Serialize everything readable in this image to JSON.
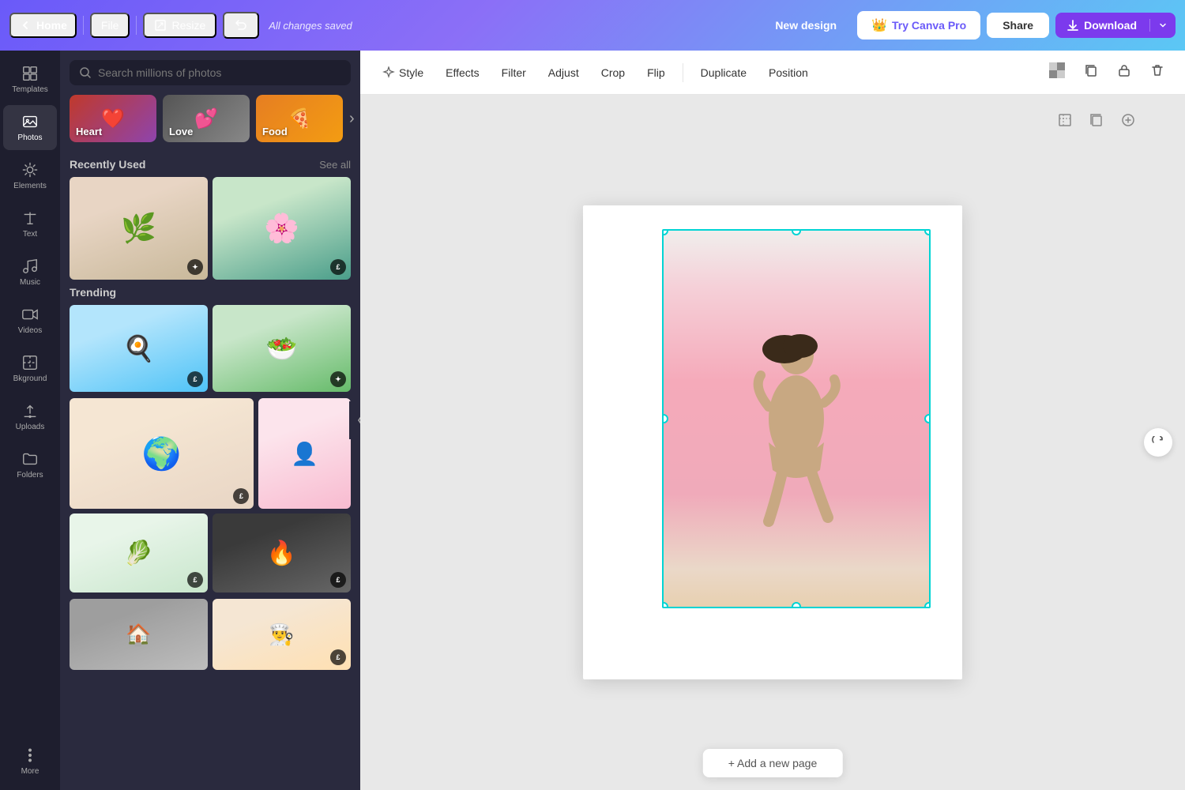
{
  "topNav": {
    "home": "Home",
    "file": "File",
    "resize": "Resize",
    "status": "All changes saved",
    "newDesign": "New design",
    "tryPro": "Try Canva Pro",
    "share": "Share",
    "download": "Download"
  },
  "sidebarIcons": [
    {
      "id": "templates",
      "label": "Templates",
      "icon": "template"
    },
    {
      "id": "photos",
      "label": "Photos",
      "icon": "image",
      "active": true
    },
    {
      "id": "elements",
      "label": "Elements",
      "icon": "elements"
    },
    {
      "id": "text",
      "label": "Text",
      "icon": "text"
    },
    {
      "id": "music",
      "label": "Music",
      "icon": "music"
    },
    {
      "id": "videos",
      "label": "Videos",
      "icon": "video"
    },
    {
      "id": "background",
      "label": "Bkground",
      "icon": "background"
    },
    {
      "id": "uploads",
      "label": "Uploads",
      "icon": "upload"
    },
    {
      "id": "folders",
      "label": "Folders",
      "icon": "folder"
    },
    {
      "id": "more",
      "label": "More",
      "icon": "more"
    }
  ],
  "leftPanel": {
    "searchPlaceholder": "Search millions of photos",
    "categories": [
      {
        "id": "heart",
        "label": "Heart",
        "emoji": "❤️"
      },
      {
        "id": "love",
        "label": "Love",
        "emoji": "💕"
      },
      {
        "id": "food",
        "label": "Food",
        "emoji": "🍕"
      }
    ],
    "recentlyUsed": "Recently Used",
    "seeAll": "See all",
    "trending": "Trending",
    "photos": [
      {
        "id": "palm",
        "class": "photo-palm",
        "badge": "✦",
        "height": "130"
      },
      {
        "id": "flowers",
        "class": "photo-flowers",
        "badge": "£",
        "height": "130"
      },
      {
        "id": "kitchen",
        "class": "photo-kitchen",
        "badge": "£",
        "height": "110"
      },
      {
        "id": "picnic",
        "class": "photo-picnic",
        "badge": "✦",
        "height": "110"
      },
      {
        "id": "earth",
        "class": "photo-earth",
        "badge": "£",
        "height": "140"
      },
      {
        "id": "girl-pink",
        "class": "photo-girl-pink",
        "badge": "",
        "height": "140"
      },
      {
        "id": "cooking",
        "class": "photo-cooking",
        "badge": "£",
        "height": "100"
      },
      {
        "id": "fireplace",
        "class": "photo-fireplace",
        "badge": "£",
        "height": "100"
      },
      {
        "id": "grid-dark",
        "class": "photo-grid-dark",
        "badge": "",
        "height": "90"
      },
      {
        "id": "chef",
        "class": "photo-chef",
        "badge": "£",
        "height": "90"
      }
    ]
  },
  "toolbar": {
    "style": "Style",
    "effects": "Effects",
    "filter": "Filter",
    "adjust": "Adjust",
    "crop": "Crop",
    "flip": "Flip",
    "duplicate": "Duplicate",
    "position": "Position"
  },
  "canvas": {
    "addPage": "+ Add a new page"
  }
}
